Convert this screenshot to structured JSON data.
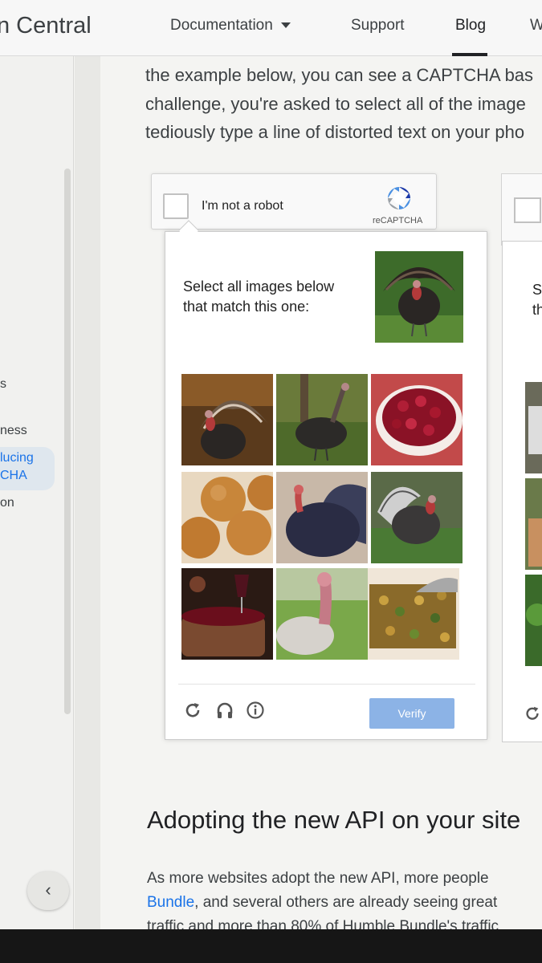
{
  "header": {
    "brand": "n Central",
    "nav": [
      "Documentation",
      "Support",
      "Blog",
      "W"
    ]
  },
  "sidebar": {
    "fragments": [
      "s",
      "ness",
      "on"
    ],
    "active_item": [
      "lucing",
      "CHA"
    ],
    "collapse_label": "‹"
  },
  "content": {
    "intro_lines": [
      "the example below, you can see a CAPTCHA bas",
      "challenge, you're asked to select all of the image",
      "tediously type a line of distorted text on your pho"
    ],
    "heading": "Adopting the new API on your site",
    "body_line1": "As more websites adopt the new API, more people",
    "body_link": "Bundle",
    "body_line2_rest": ", and several others are already seeing great",
    "body_line3": "traffic and more than 80% of Humble Bundle's traffic"
  },
  "captcha": {
    "checkbox_label": "I'm not a robot",
    "brand": "reCAPTCHA",
    "instruction_line1": "Select all images below",
    "instruction_line2": "that match this one:",
    "sample": "turkey",
    "tiles": [
      "turkey",
      "turkey",
      "cranberries",
      "bread rolls",
      "turkey",
      "turkey",
      "roast dish",
      "turkey",
      "stuffing"
    ],
    "footer_icons": [
      "reload-icon",
      "audio-icon",
      "info-icon"
    ],
    "verify_label": "Verify"
  },
  "captcha2": {
    "instruction_line1": "S",
    "instruction_line2": "th"
  },
  "colors": {
    "link": "#1a73e8",
    "verify": "#8cb3e6",
    "active_item_bg": "#dfe7ee"
  }
}
